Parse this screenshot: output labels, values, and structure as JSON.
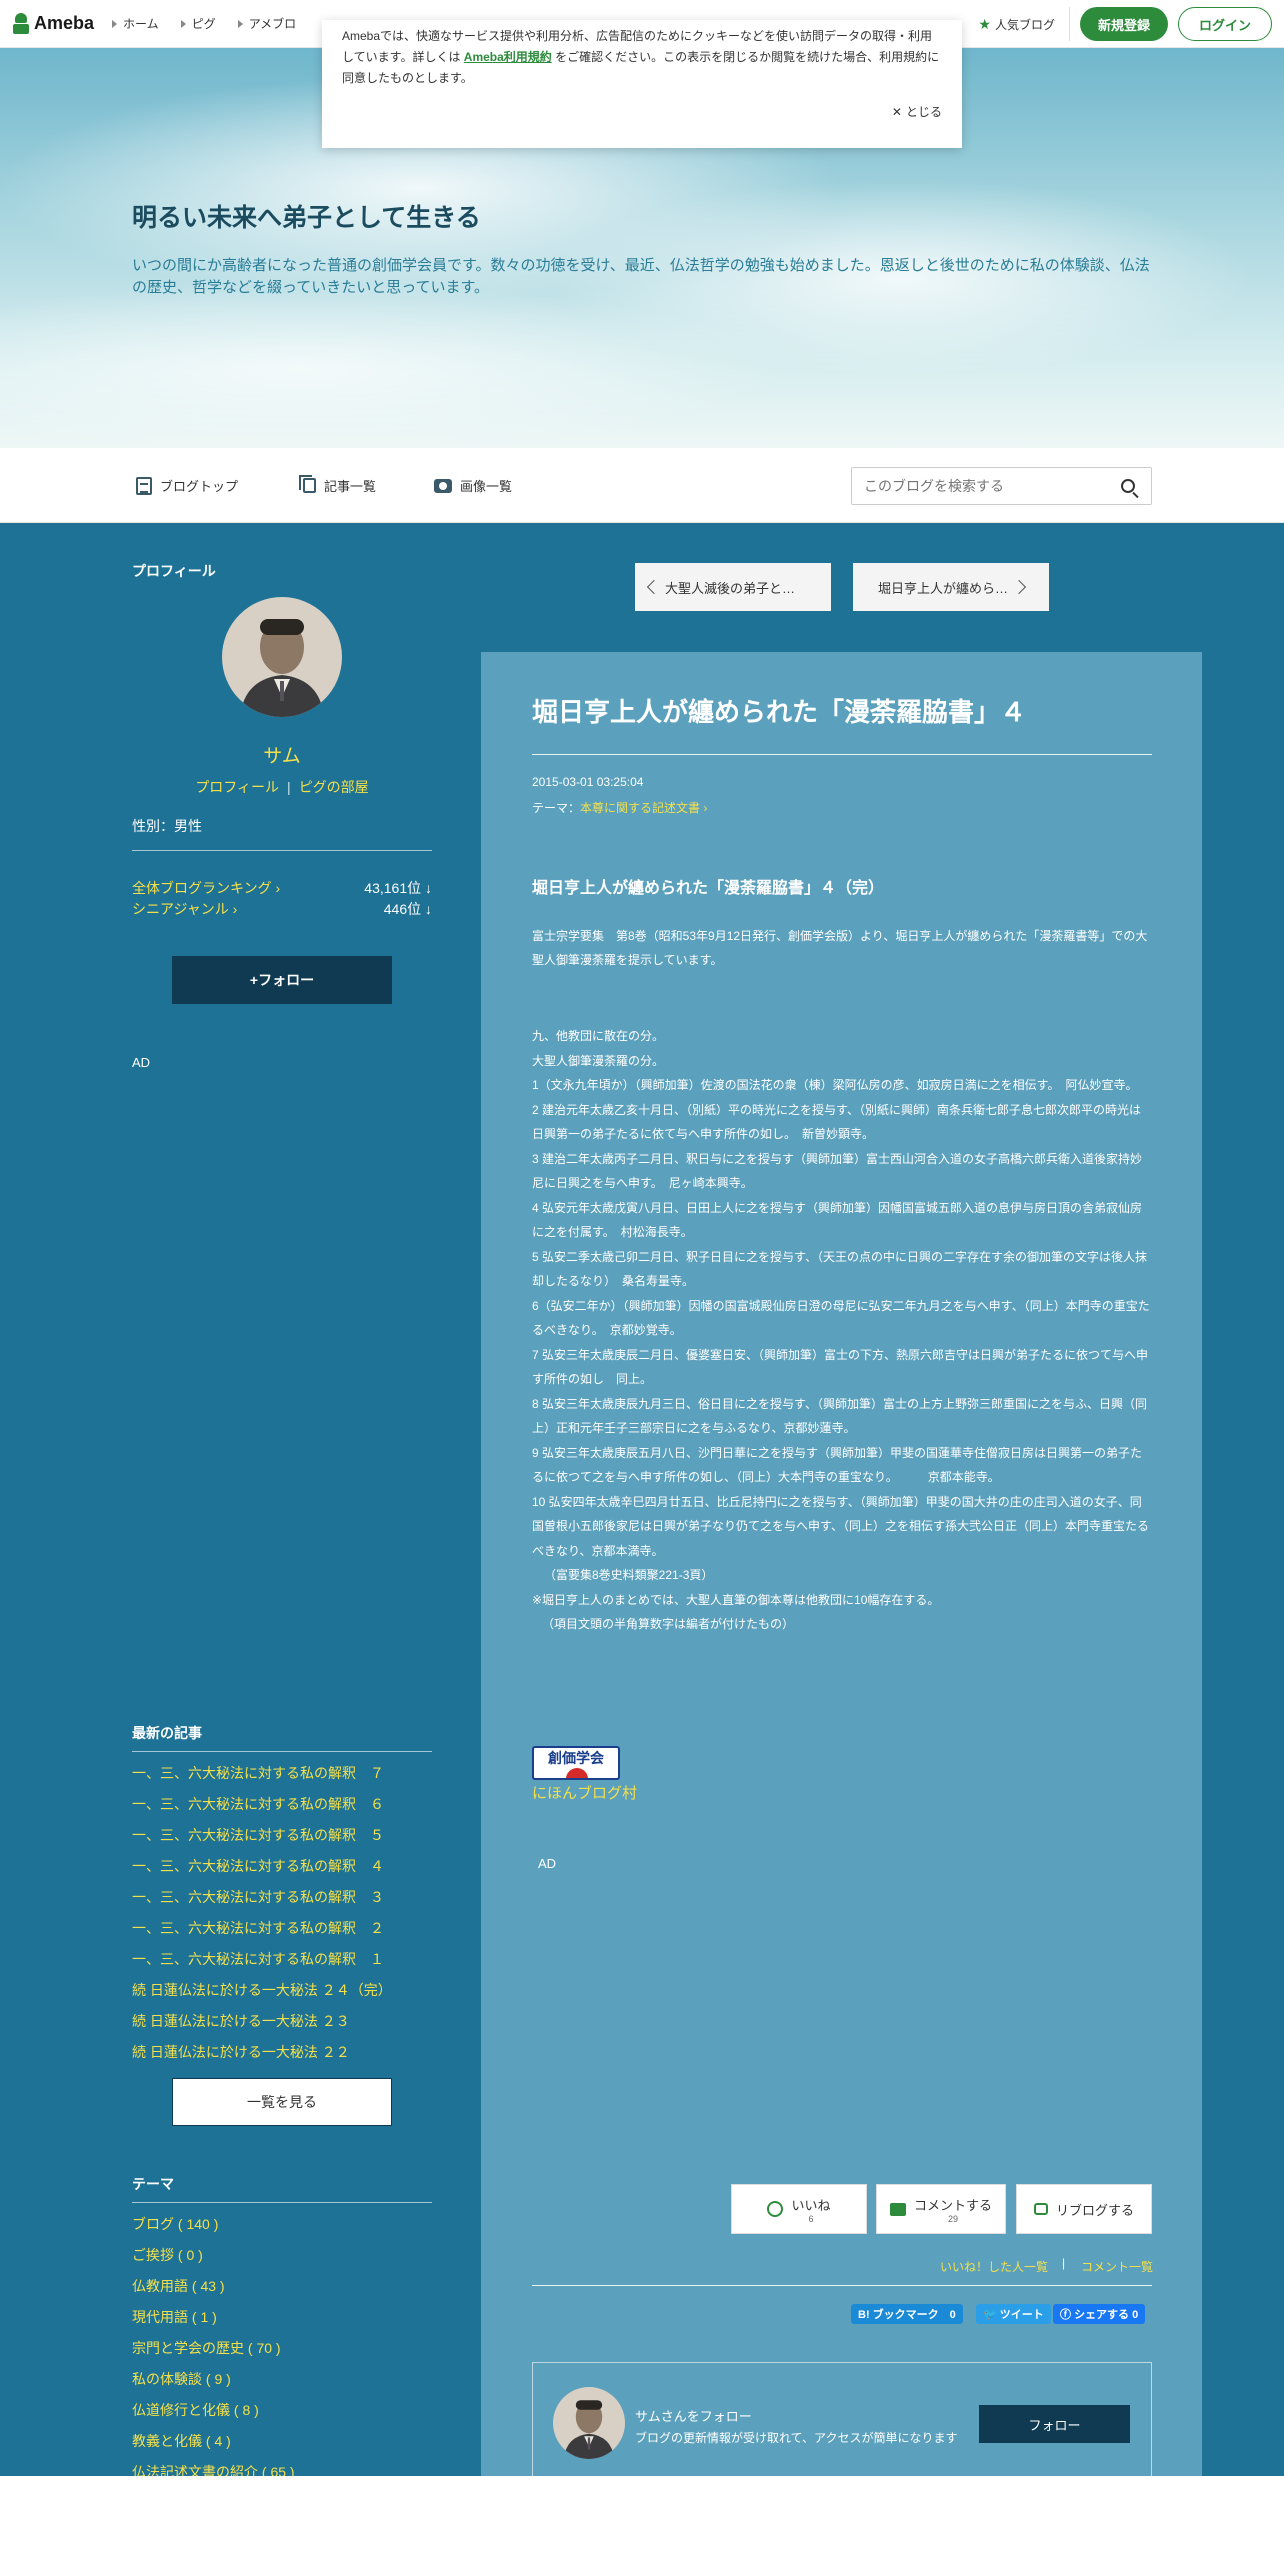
{
  "nav": {
    "logo": "Ameba",
    "links": [
      "ホーム",
      "ピグ",
      "アメブロ"
    ],
    "popular": "人気ブログ",
    "signup": "新規登録",
    "login": "ログイン"
  },
  "cookie": {
    "text_before": "Amebaでは、快適なサービス提供や利用分析、広告配信のためにクッキーなどを使い訪問データの取得・利用しています。詳しくは",
    "link": "Ameba利用規約",
    "text_after": "をご確認ください。この表示を閉じるか閲覧を続けた場合、利用規約に同意したものとします。",
    "close": "とじる"
  },
  "blog": {
    "title": "明るい未来へ弟子として生きる",
    "description": "いつの間にか高齢者になった普通の創価学会員です。数々の功徳を受け、最近、仏法哲学の勉強も始めました。恩返しと後世のために私の体験談、仏法の歴史、哲学などを綴っていきたいと思っています。"
  },
  "menu": {
    "top": "ブログトップ",
    "articles": "記事一覧",
    "images": "画像一覧",
    "search_placeholder": "このブログを検索する"
  },
  "sidebar": {
    "profile_heading": "プロフィール",
    "nickname": "サム",
    "profile_link": "プロフィール",
    "pigg_link": "ピグの部屋",
    "gender": "性別：男性",
    "rank_all_label": "全体ブログランキング",
    "rank_all_value": "43,161位 ↓",
    "rank_genre_label": "シニアジャンル",
    "rank_genre_value": "446位 ↓",
    "follow": "フォロー",
    "ad": "AD",
    "recent_heading": "最新の記事",
    "recent": [
      "一、三、六大秘法に対する私の解釈　７",
      "一、三、六大秘法に対する私の解釈　６",
      "一、三、六大秘法に対する私の解釈　５",
      "一、三、六大秘法に対する私の解釈　４",
      "一、三、六大秘法に対する私の解釈　３",
      "一、三、六大秘法に対する私の解釈　２",
      "一、三、六大秘法に対する私の解釈　１",
      "続 日蓮仏法に於ける一大秘法 ２４（完）",
      "続 日蓮仏法に於ける一大秘法 ２３",
      "続 日蓮仏法に於ける一大秘法 ２２"
    ],
    "see_all": "一覧を見る",
    "theme_heading": "テーマ",
    "themes": [
      "ブログ ( 140 )",
      "ご挨拶 ( 0 )",
      "仏教用語 ( 43 )",
      "現代用語 ( 1 )",
      "宗門と学会の歴史 ( 70 )",
      "私の体験談 ( 9 )",
      "仏道修行と化儀 ( 8 )",
      "教義と化儀 ( 4 )",
      "仏法記述文書の紹介 ( 65 )"
    ]
  },
  "pager": {
    "prev": "大聖人滅後の弟子と…",
    "next": "堀日亨上人が纏めら…"
  },
  "article": {
    "title": "堀日亨上人が纏められた「漫荼羅脇書」４",
    "date": "2015-03-01 03:25:04",
    "theme_label": "テーマ：",
    "theme": "本尊に関する記述文書",
    "subtitle": "堀日亨上人が纏められた「漫荼羅脇書」４（完）",
    "intro": "富士宗学要集　第8巻（昭和53年9月12日発行、創価学会版）より、堀日亨上人が纏められた「漫荼羅書等」での大聖人御筆漫荼羅を提示しています。",
    "body": [
      "九、他教団に散在の分。",
      "大聖人御筆漫荼羅の分。",
      "1（文永九年頃か）（興師加筆）佐渡の国法花の衆（棟）梁阿仏房の彦、如寂房日満に之を相伝す。　阿仏妙宣寺。",
      "2 建治元年太歳乙亥十月日、（別紙）平の時光に之を授与す、（別紙に興師）南条兵衛七郎子息七郎次郎平の時光は日興第一の弟子たるに依て与へ申す所件の如し。　新曽妙顕寺。",
      "3 建治二年太歳丙子二月日、釈日与に之を授与す（興師加筆）富士西山河合入道の女子高橋六郎兵衛入道後家持妙尼に日興之を与へ申す。　尼ヶ崎本興寺。",
      "4 弘安元年太歳戊寅八月日、日田上人に之を授与す（興師加筆）因幡国富城五郎入道の息伊与房日頂の舎弟寂仙房に之を付属す。　村松海長寺。",
      "5 弘安二季太歳己卯二月日、釈子日目に之を授与す、（天王の点の中に日興の二字存在す余の御加筆の文字は後人抹却したるなり）　桑名寿量寺。",
      "6（弘安二年か）（興師加筆）因幡の国富城殿仙房日澄の母尼に弘安二年九月之を与へ申す、（同上）本門寺の重宝たるべきなり。　京都妙覚寺。",
      "7 弘安三年太歳庚辰二月日、優婆塞日安、（興師加筆）富士の下方、熱原六郎吉守は日興が弟子たるに依つて与へ申す所件の如し　同上。",
      "8 弘安三年太歳庚辰九月三日、俗日目に之を授与す、（興師加筆）富士の上方上野弥三郎重国に之を与ふ、日興（同上）正和元年壬子三部宗日に之を与ふるなり、京都妙蓮寺。",
      "9 弘安三年太歳庚辰五月八日、沙門日華に之を授与す（興師加筆）甲斐の国蓮華寺住僧寂日房は日興第一の弟子たるに依つて之を与へ申す所件の如し、（同上）大本門寺の重宝なり。　　　京都本能寺。",
      "10 弘安四年太歳辛巳四月廿五日、比丘尼持円に之を授与す、（興師加筆）甲斐の国大井の庄の庄司入道の女子、同国曽根小五郎後家尼は日興が弟子なり仍て之を与へ申す、（同上）之を相伝す孫大弐公日正（同上）本門寺重宝たるべきなり、京都本満寺。",
      "（富要集8巻史料類聚221-3頁）",
      "※堀日亨上人のまとめでは、大聖人直筆の御本尊は他教団に10幅存在する。",
      "（項目文頭の半角算数字は編者が付けたもの）"
    ],
    "banner_text": "創価学会",
    "banner_link": "にほんブログ村",
    "ad": "AD",
    "like_label": "いいね",
    "like_count": "6",
    "comment_label": "コメントする",
    "comment_count": "29",
    "reblog_label": "リブログする",
    "liked_list": "いいね！した人一覧",
    "comment_list": "コメント一覧",
    "hatena": "B! ブックマーク　0",
    "tweet": "ツイート",
    "facebook": "シェアする 0",
    "follow_name": "サムさんをフォロー",
    "follow_sub": "ブログの更新情報が受け取れて、アクセスが簡単になります",
    "follow_btn": "フォロー"
  },
  "colors": {
    "page_bg": "#1e7296",
    "article_bg": "#5ba0bc",
    "link_yellow": "#f4e04a",
    "brand_green": "#2d8c3c",
    "dark_button": "#0f3a52"
  }
}
